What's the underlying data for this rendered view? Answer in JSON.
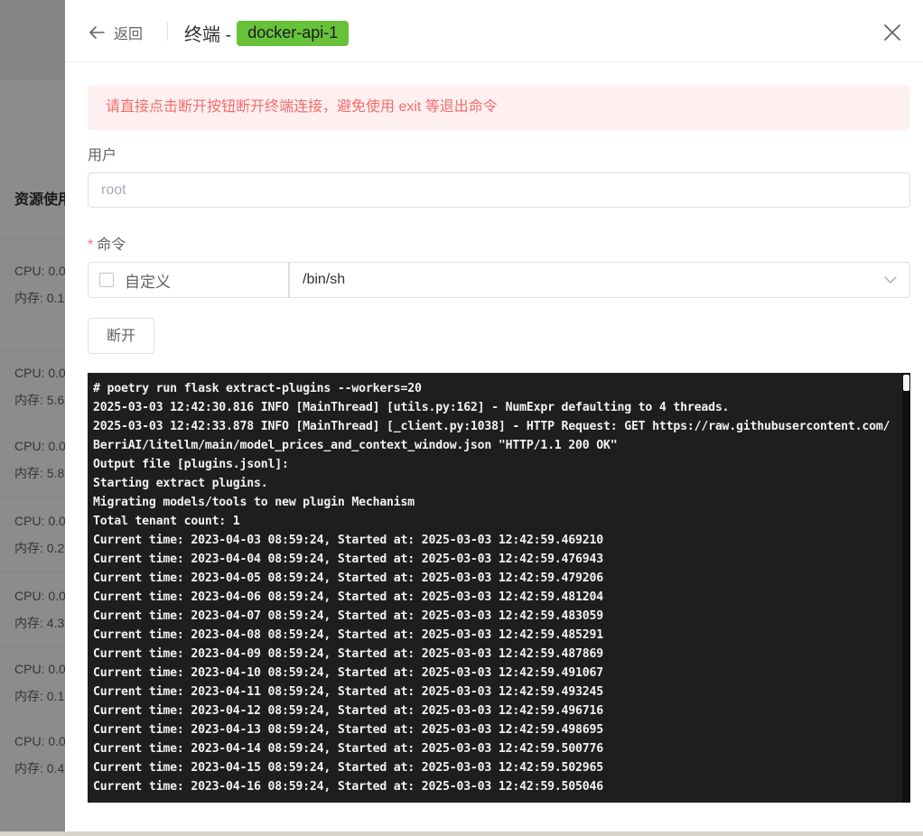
{
  "background": {
    "section_title": "资源使用",
    "rows": [
      {
        "cpu": "CPU: 0.0",
        "mem": "内存: 0.1"
      },
      {
        "cpu": "CPU: 0.0",
        "mem": "内存: 5.6"
      },
      {
        "cpu": "CPU: 0.0",
        "mem": "内存: 5.8"
      },
      {
        "cpu": "CPU: 0.0",
        "mem": "内存: 0.2"
      },
      {
        "cpu": "CPU: 0.0",
        "mem": "内存: 4.3"
      },
      {
        "cpu": "CPU: 0.0",
        "mem": "内存: 0.1"
      },
      {
        "cpu": "CPU: 0.0",
        "mem": "内存: 0.4"
      }
    ]
  },
  "header": {
    "back_label": "返回",
    "title": "终端 -",
    "container_tag": "docker-api-1",
    "tag_color": "#67c23a"
  },
  "alert": {
    "text": "请直接点击断开按钮断开终端连接，避免使用 exit 等退出命令"
  },
  "form": {
    "user_label": "用户",
    "user_placeholder": "root",
    "command_label": "命令",
    "custom_label": "自定义",
    "command_value": "/bin/sh",
    "disconnect_label": "断开"
  },
  "terminal": {
    "lines": [
      "# poetry run flask extract-plugins --workers=20",
      "2025-03-03 12:42:30.816 INFO [MainThread] [utils.py:162] - NumExpr defaulting to 4 threads.",
      "2025-03-03 12:42:33.878 INFO [MainThread] [_client.py:1038] - HTTP Request: GET https://raw.githubusercontent.com/BerriAI/litellm/main/model_prices_and_context_window.json \"HTTP/1.1 200 OK\"",
      "Output file [plugins.jsonl]:",
      "Starting extract plugins.",
      "Migrating models/tools to new plugin Mechanism",
      "Total tenant count: 1",
      "Current time: 2023-04-03 08:59:24, Started at: 2025-03-03 12:42:59.469210",
      "Current time: 2023-04-04 08:59:24, Started at: 2025-03-03 12:42:59.476943",
      "Current time: 2023-04-05 08:59:24, Started at: 2025-03-03 12:42:59.479206",
      "Current time: 2023-04-06 08:59:24, Started at: 2025-03-03 12:42:59.481204",
      "Current time: 2023-04-07 08:59:24, Started at: 2025-03-03 12:42:59.483059",
      "Current time: 2023-04-08 08:59:24, Started at: 2025-03-03 12:42:59.485291",
      "Current time: 2023-04-09 08:59:24, Started at: 2025-03-03 12:42:59.487869",
      "Current time: 2023-04-10 08:59:24, Started at: 2025-03-03 12:42:59.491067",
      "Current time: 2023-04-11 08:59:24, Started at: 2025-03-03 12:42:59.493245",
      "Current time: 2023-04-12 08:59:24, Started at: 2025-03-03 12:42:59.496716",
      "Current time: 2023-04-13 08:59:24, Started at: 2025-03-03 12:42:59.498695",
      "Current time: 2023-04-14 08:59:24, Started at: 2025-03-03 12:42:59.500776",
      "Current time: 2023-04-15 08:59:24, Started at: 2025-03-03 12:42:59.502965",
      "Current time: 2023-04-16 08:59:24, Started at: 2025-03-03 12:42:59.505046"
    ]
  }
}
